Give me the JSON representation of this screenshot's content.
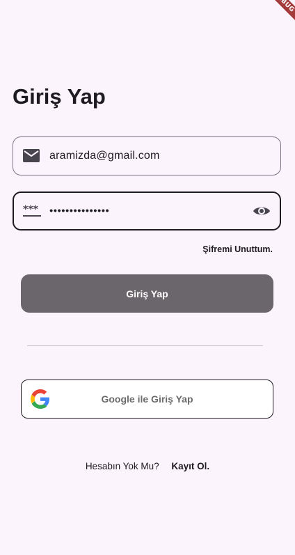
{
  "debug_banner": "DEBUG",
  "page_title": "Giriş Yap",
  "email_field": {
    "icon": "mail-icon",
    "value": "aramizda@gmail.com"
  },
  "password_field": {
    "icon": "password-icon",
    "icon_text": "***",
    "value": "•••••••••••••••",
    "toggle_icon": "eye-icon"
  },
  "forgot_password_label": "Şifremi Unuttum.",
  "login_button_label": "Giriş Yap",
  "google_button": {
    "icon": "google-icon",
    "label": "Google ile Giriş Yap"
  },
  "signup": {
    "question": "Hesabın Yok Mu?",
    "link_label": "Kayıt Ol."
  },
  "colors": {
    "background": "#fcf4fc",
    "primary_button": "#6b666b",
    "text": "#1d1b20",
    "debug_banner": "#a33b3b"
  }
}
